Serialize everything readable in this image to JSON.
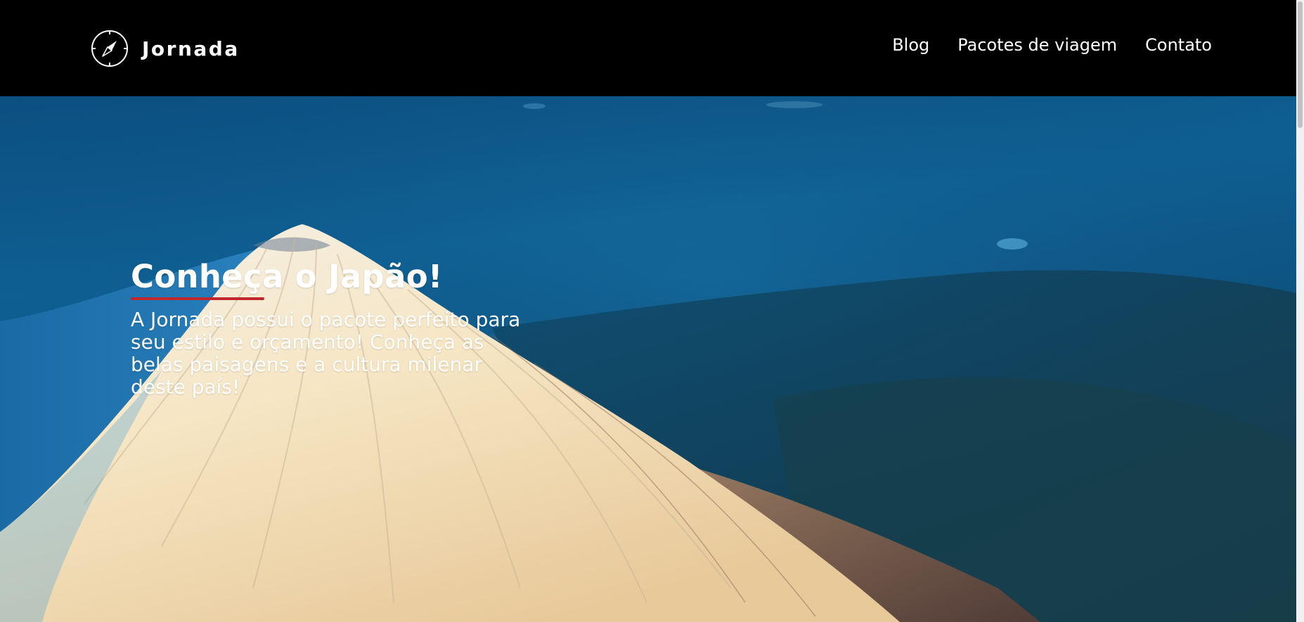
{
  "header": {
    "brand": {
      "name": "Jornada",
      "icon": "compass-icon"
    },
    "nav": [
      {
        "label": "Blog"
      },
      {
        "label": "Pacotes de viagem"
      },
      {
        "label": "Contato"
      }
    ]
  },
  "hero": {
    "title": "Conheça o Japão!",
    "text": "A Jornada possui o pacote perfeito para seu estilo e orçamento! Conheça as belas paisagens e a cultura milenar deste país!",
    "background": "mount-fuji-aerial-photo",
    "accent_color": "#c0282d"
  },
  "colors": {
    "header_bg": "#000000",
    "text": "#ffffff",
    "accent": "#c0282d",
    "sky": "#0f5d8f"
  }
}
